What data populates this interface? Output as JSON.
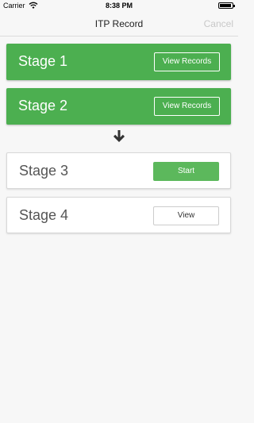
{
  "status_bar": {
    "carrier": "Carrier",
    "time": "8:38 PM",
    "icons": [
      "wifi-icon",
      "battery-icon"
    ]
  },
  "nav": {
    "title": "ITP Record",
    "cancel_label": "Cancel",
    "colors": {
      "cancel": "#c8c8c8"
    }
  },
  "stages": [
    {
      "label": "Stage 1",
      "button": "View Records",
      "state": "completed"
    },
    {
      "label": "Stage 2",
      "button": "View Records",
      "state": "completed"
    },
    {
      "label": "Stage 3",
      "button": "Start",
      "state": "current"
    },
    {
      "label": "Stage 4",
      "button": "View",
      "state": "pending"
    }
  ],
  "connector_icon": "arrow-down-icon",
  "colors": {
    "completed": "#4caf50",
    "start_button": "#5cb85c",
    "background": "#f7f7f7"
  }
}
